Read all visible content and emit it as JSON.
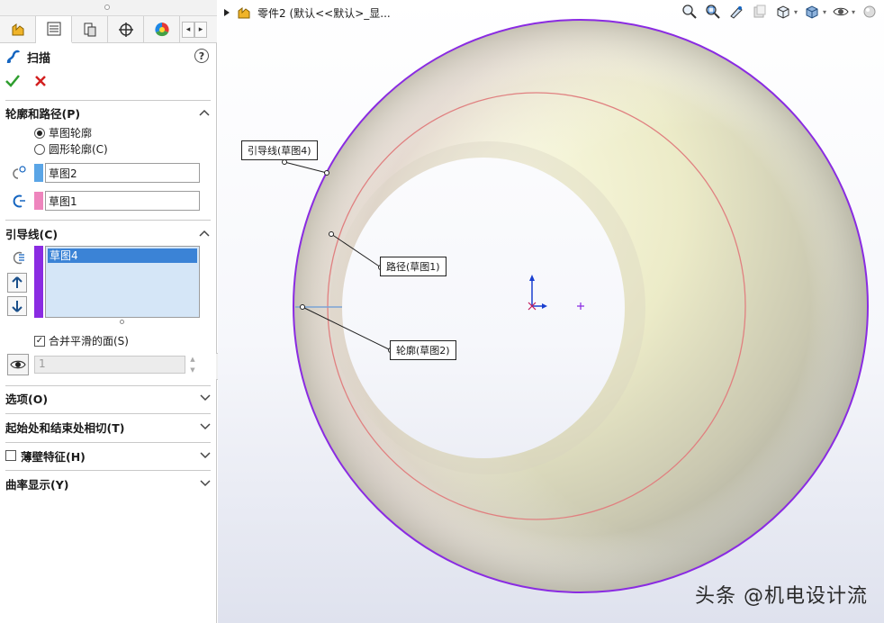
{
  "tabs": {
    "icons": [
      "feature-manager-icon",
      "property-manager-icon",
      "configuration-manager-icon",
      "dimxpert-icon",
      "display-manager-icon"
    ],
    "scroll_left": "◂",
    "scroll_right": "▸"
  },
  "property_manager": {
    "title": "扫描",
    "help": "?",
    "ok_icon": "check-icon",
    "cancel_icon": "cross-icon"
  },
  "profile_path": {
    "heading": "轮廓和路径(P)",
    "options": [
      "草图轮廓",
      "圆形轮廓(C)"
    ],
    "selected_option": "草图轮廓",
    "profile_value": "草图2",
    "path_value": "草图1",
    "profile_color": "#5aa5e6",
    "path_color": "#ee85bd"
  },
  "guide_curves": {
    "heading": "引导线(C)",
    "items": [
      "草图4"
    ],
    "color": "#8a2be2",
    "merge_label": "合并平滑的面(S)",
    "merge_checked": "☑",
    "count_value": "1"
  },
  "collapsed_sections": [
    "选项(O)",
    "起始处和结束处相切(T)",
    "薄壁特征(H)",
    "曲率显示(Y)"
  ],
  "thin_feature_checked": false,
  "breadcrumb": {
    "text": "零件2  (默认<<默认>_显..."
  },
  "callouts": {
    "guide": "引导线(草图4)",
    "path": "路径(草图1)",
    "profile": "轮廓(草图2)"
  },
  "watermark": "头条 @机电设计流",
  "colors": {
    "torus_outline": "#8a2be2",
    "path_circle": "#e08080",
    "torus_fill": "#ecebc8"
  }
}
